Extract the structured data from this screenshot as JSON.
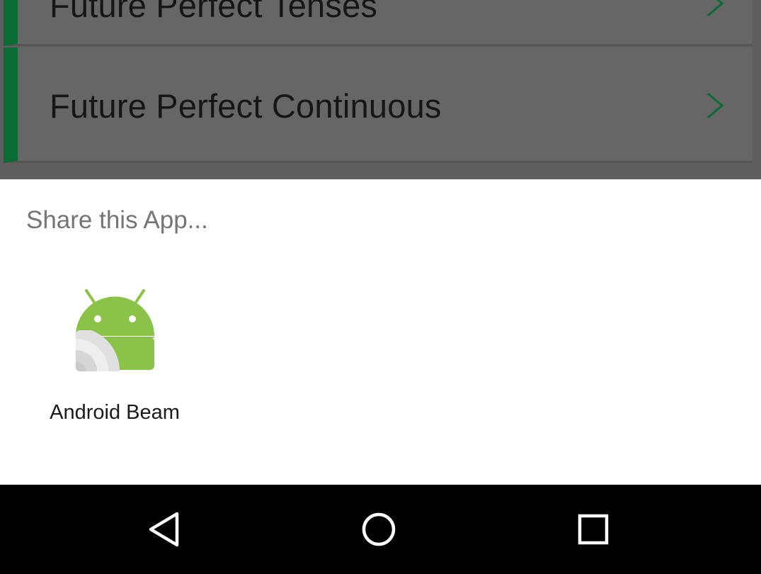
{
  "background_list": {
    "rows": [
      {
        "label": "Future Perfect Tenses"
      },
      {
        "label": "Future Perfect Continuous"
      }
    ],
    "accent_color": "#0a6b34"
  },
  "share_sheet": {
    "title": "Share this App...",
    "targets": [
      {
        "label": "Android Beam",
        "icon": "android-beam-icon"
      }
    ]
  },
  "nav_bar": {
    "buttons": [
      {
        "icon": "back-triangle-icon"
      },
      {
        "icon": "home-circle-icon"
      },
      {
        "icon": "recents-square-icon"
      }
    ]
  }
}
